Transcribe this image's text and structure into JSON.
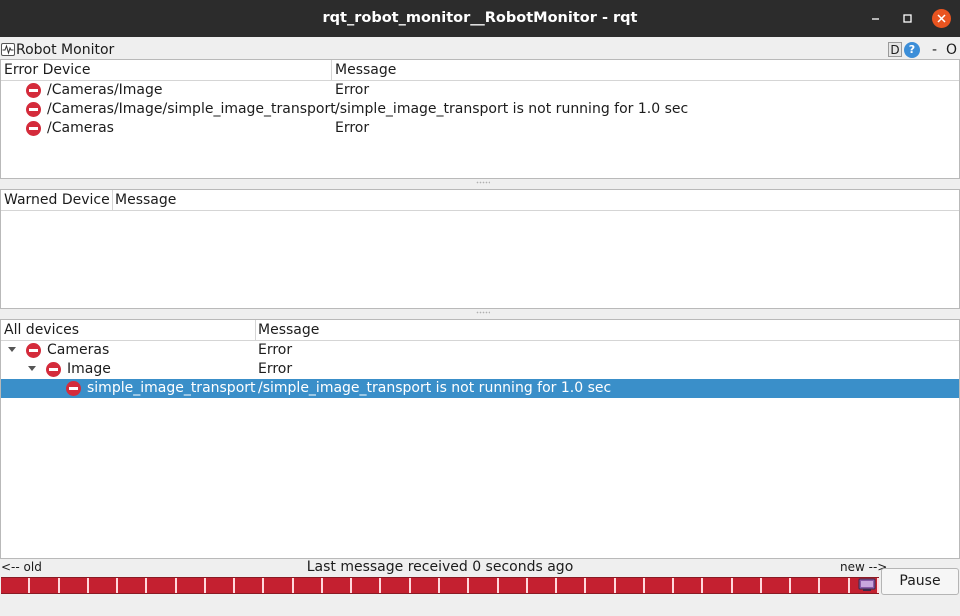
{
  "window": {
    "title": "rqt_robot_monitor__RobotMonitor - rqt",
    "icons": [
      "minimize-icon",
      "maximize-icon",
      "close-icon"
    ]
  },
  "plugin": {
    "title": "Robot Monitor",
    "d_label": "D",
    "help_label": "?",
    "dash_label": "-",
    "o_label": "O"
  },
  "error_panel": {
    "columns": [
      "Error Device",
      "Message"
    ],
    "rows": [
      {
        "device": "/Cameras/Image",
        "message": "Error"
      },
      {
        "device": "/Cameras/Image/simple_image_transport",
        "message": "/simple_image_transport is not running for 1.0 sec"
      },
      {
        "device": "/Cameras",
        "message": "Error"
      }
    ]
  },
  "warn_panel": {
    "columns": [
      "Warned Device",
      "Message"
    ],
    "rows": []
  },
  "all_panel": {
    "columns": [
      "All devices",
      "Message"
    ],
    "rows": [
      {
        "name": "Cameras",
        "message": "Error",
        "level": 0,
        "expanded": true,
        "selected": false
      },
      {
        "name": "Image",
        "message": "Error",
        "level": 1,
        "expanded": true,
        "selected": false
      },
      {
        "name": "simple_image_transport",
        "message": "/simple_image_transport is not running for 1.0 sec",
        "level": 2,
        "expanded": false,
        "selected": true
      }
    ]
  },
  "status": {
    "old_label": "<-- old",
    "message": "Last message received 0 seconds ago",
    "new_label": "new -->"
  },
  "timeline": {
    "segments": 30,
    "state": "error",
    "color": "#c42030"
  },
  "pause_button": {
    "label": "Pause"
  },
  "colors": {
    "accent_close": "#e95420",
    "error_icon": "#d42b3b",
    "selection": "#3a8fc9"
  }
}
